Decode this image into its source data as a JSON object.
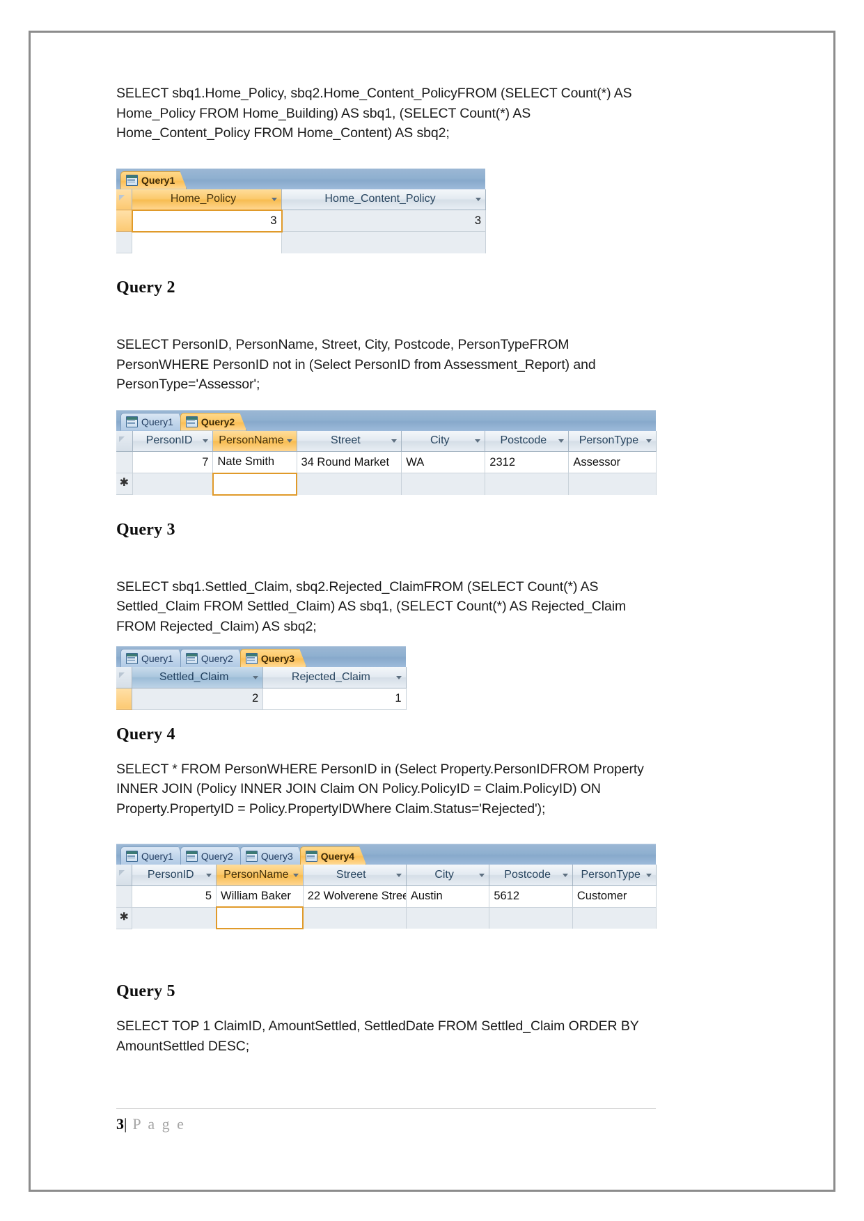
{
  "document": {
    "footer": {
      "page_number": "3",
      "separator": "|",
      "label": "P a g e"
    }
  },
  "sections": [
    {
      "id": "query1",
      "sql": "SELECT sbq1.Home_Policy, sbq2.Home_Content_PolicyFROM (SELECT Count(*) AS Home_Policy FROM Home_Building)  AS sbq1, (SELECT Count(*) AS Home_Content_Policy FROM Home_Content)  AS sbq2;",
      "table": {
        "tabs": [
          {
            "label": "Query1",
            "active": true
          }
        ],
        "columns": [
          "Home_Policy",
          "Home_Content_Policy"
        ],
        "rows": [
          [
            "3",
            "3"
          ]
        ]
      }
    },
    {
      "id": "query2",
      "heading": "Query 2",
      "sql": "SELECT PersonID, PersonName, Street, City, Postcode, PersonTypeFROM PersonWHERE PersonID not in (Select PersonID from Assessment_Report) and PersonType='Assessor';",
      "table": {
        "tabs": [
          {
            "label": "Query1",
            "active": false
          },
          {
            "label": "Query2",
            "active": true
          }
        ],
        "columns": [
          "PersonID",
          "PersonName",
          "Street",
          "City",
          "Postcode",
          "PersonType"
        ],
        "rows": [
          [
            "7",
            "Nate Smith",
            "34 Round Market",
            "WA",
            "2312",
            "Assessor"
          ]
        ],
        "new_record_marker": "✱"
      }
    },
    {
      "id": "query3",
      "heading": "Query 3",
      "sql": "SELECT sbq1.Settled_Claim, sbq2.Rejected_ClaimFROM (SELECT Count(*) AS Settled_Claim FROM Settled_Claim)  AS sbq1, (SELECT Count(*) AS Rejected_Claim FROM Rejected_Claim) AS sbq2;",
      "table": {
        "tabs": [
          {
            "label": "Query1",
            "active": false
          },
          {
            "label": "Query2",
            "active": false
          },
          {
            "label": "Query3",
            "active": true
          }
        ],
        "columns": [
          "Settled_Claim",
          "Rejected_Claim"
        ],
        "rows": [
          [
            "2",
            "1"
          ]
        ]
      }
    },
    {
      "id": "query4",
      "heading": "Query 4",
      "sql": "SELECT * FROM PersonWHERE PersonID in (Select Property.PersonIDFROM Property INNER JOIN (Policy INNER JOIN Claim ON Policy.PolicyID = Claim.PolicyID) ON Property.PropertyID = Policy.PropertyIDWhere Claim.Status='Rejected');",
      "table": {
        "tabs": [
          {
            "label": "Query1",
            "active": false
          },
          {
            "label": "Query2",
            "active": false
          },
          {
            "label": "Query3",
            "active": false
          },
          {
            "label": "Query4",
            "active": true
          }
        ],
        "columns": [
          "PersonID",
          "PersonName",
          "Street",
          "City",
          "Postcode",
          "PersonType"
        ],
        "rows": [
          [
            "5",
            "William Baker",
            "22 Wolverene Stree",
            "Austin",
            "5612",
            "Customer"
          ]
        ],
        "new_record_marker": "✱"
      }
    },
    {
      "id": "query5",
      "heading": "Query 5",
      "sql": "SELECT TOP 1 ClaimID, AmountSettled, SettledDate FROM Settled_Claim ORDER BY AmountSettled DESC;"
    }
  ],
  "colors": {
    "accent_orange": "#fbc96a",
    "tab_blue": "#9bb7d4",
    "header_grey": "#e3eaf1",
    "text": "#1a1a1a"
  }
}
